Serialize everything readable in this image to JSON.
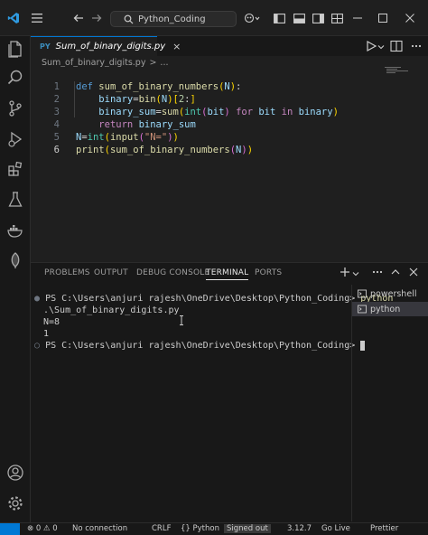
{
  "titlebar": {
    "search_text": "Python_Coding",
    "icons": [
      "vscode-logo-icon",
      "menu-icon",
      "back-arrow-icon",
      "forward-arrow-icon",
      "search-icon",
      "copilot-icon",
      "toggle-sidebar-icon",
      "toggle-panel-icon",
      "toggle-secondary-sidebar-icon",
      "layout-icon",
      "minimize-icon",
      "maximize-icon",
      "close-icon"
    ]
  },
  "activitybar": {
    "icons": [
      "explorer-icon",
      "search-icon",
      "source-control-icon",
      "run-debug-icon",
      "extensions-icon",
      "testing-icon",
      "docker-icon",
      "leaf-icon",
      "account-icon",
      "settings-gear-icon"
    ]
  },
  "tab": {
    "lang_badge": "PY",
    "name": "Sum_of_binary_digits.py",
    "close": "×"
  },
  "breadcrumb": {
    "file": "Sum_of_binary_digits.py",
    "sep": ">",
    "rest": "..."
  },
  "editor": {
    "line_numbers": [
      "1",
      "2",
      "3",
      "4",
      "5",
      "6"
    ],
    "active_line": 6
  },
  "panel": {
    "tabs": [
      "PROBLEMS",
      "OUTPUT",
      "DEBUG CONSOLE",
      "TERMINAL",
      "PORTS"
    ],
    "active_tab": "TERMINAL",
    "terminal_lines": [
      "PS C:\\Users\\anjuri rajesh\\OneDrive\\Desktop\\Python_Coding> ",
      "python",
      ".\\Sum_of_binary_digits.py",
      "N=8",
      "1",
      "PS C:\\Users\\anjuri rajesh\\OneDrive\\Desktop\\Python_Coding> "
    ],
    "terminals": [
      "powershell",
      "python"
    ],
    "selected_terminal": "python"
  },
  "statusbar": {
    "items": [
      "⊗ 0 ⚠ 0",
      "No connection",
      "CRLF",
      "{} Python",
      "Signed out",
      "3.12.7",
      "Go Live",
      "Prettier"
    ]
  }
}
